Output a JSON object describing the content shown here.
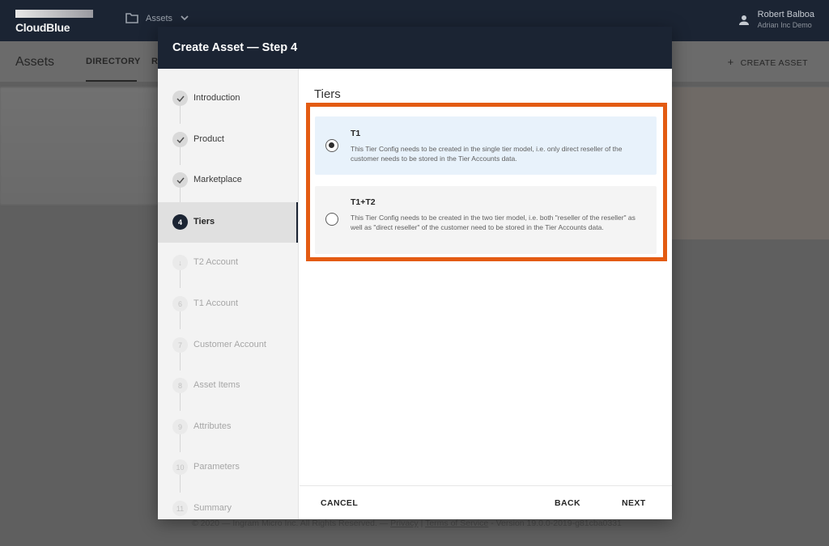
{
  "topbar": {
    "logo_text": "CloudBlue",
    "nav_label": "Assets",
    "user_name": "Robert Balboa",
    "user_org": "Adrian Inc Demo"
  },
  "pagebar": {
    "title": "Assets",
    "tabs": [
      "DIRECTORY",
      "R"
    ],
    "create_label": "CREATE ASSET"
  },
  "footer": {
    "prefix": "© 2020 — Ingram Micro Inc. All Rights Reserved. —",
    "privacy": "Privacy",
    "sep": "|",
    "terms": "Terms of Service",
    "version": "- Version 19.0.0-2019-g81cba0331"
  },
  "modal": {
    "title": "Create Asset — Step 4",
    "steps": [
      {
        "marker": "✓",
        "label": "Introduction",
        "state": "done"
      },
      {
        "marker": "✓",
        "label": "Product",
        "state": "done"
      },
      {
        "marker": "✓",
        "label": "Marketplace",
        "state": "done"
      },
      {
        "marker": "4",
        "label": "Tiers",
        "state": "current"
      },
      {
        "marker": "↓",
        "label": "T2 Account",
        "state": "pending"
      },
      {
        "marker": "6",
        "label": "T1 Account",
        "state": "pending"
      },
      {
        "marker": "7",
        "label": "Customer Account",
        "state": "pending"
      },
      {
        "marker": "8",
        "label": "Asset Items",
        "state": "pending"
      },
      {
        "marker": "9",
        "label": "Attributes",
        "state": "pending"
      },
      {
        "marker": "10",
        "label": "Parameters",
        "state": "pending"
      },
      {
        "marker": "11",
        "label": "Summary",
        "state": "pending"
      }
    ],
    "section_title": "Tiers",
    "options": [
      {
        "title": "T1",
        "description": "This Tier Config needs to be created in the single tier model, i.e. only direct reseller of the customer needs to be stored in the Tier Accounts data.",
        "selected": true
      },
      {
        "title": "T1+T2",
        "description": "This Tier Config needs to be created in the two tier model, i.e. both \"reseller of the reseller\" as well as \"direct reseller\" of the customer need to be stored in the Tier Accounts data.",
        "selected": false
      }
    ],
    "buttons": {
      "cancel": "CANCEL",
      "back": "BACK",
      "next": "NEXT"
    }
  },
  "colors": {
    "header_bg": "#1b2433",
    "highlight_border": "#e35b12",
    "selected_option_bg": "#e8f2fb"
  }
}
